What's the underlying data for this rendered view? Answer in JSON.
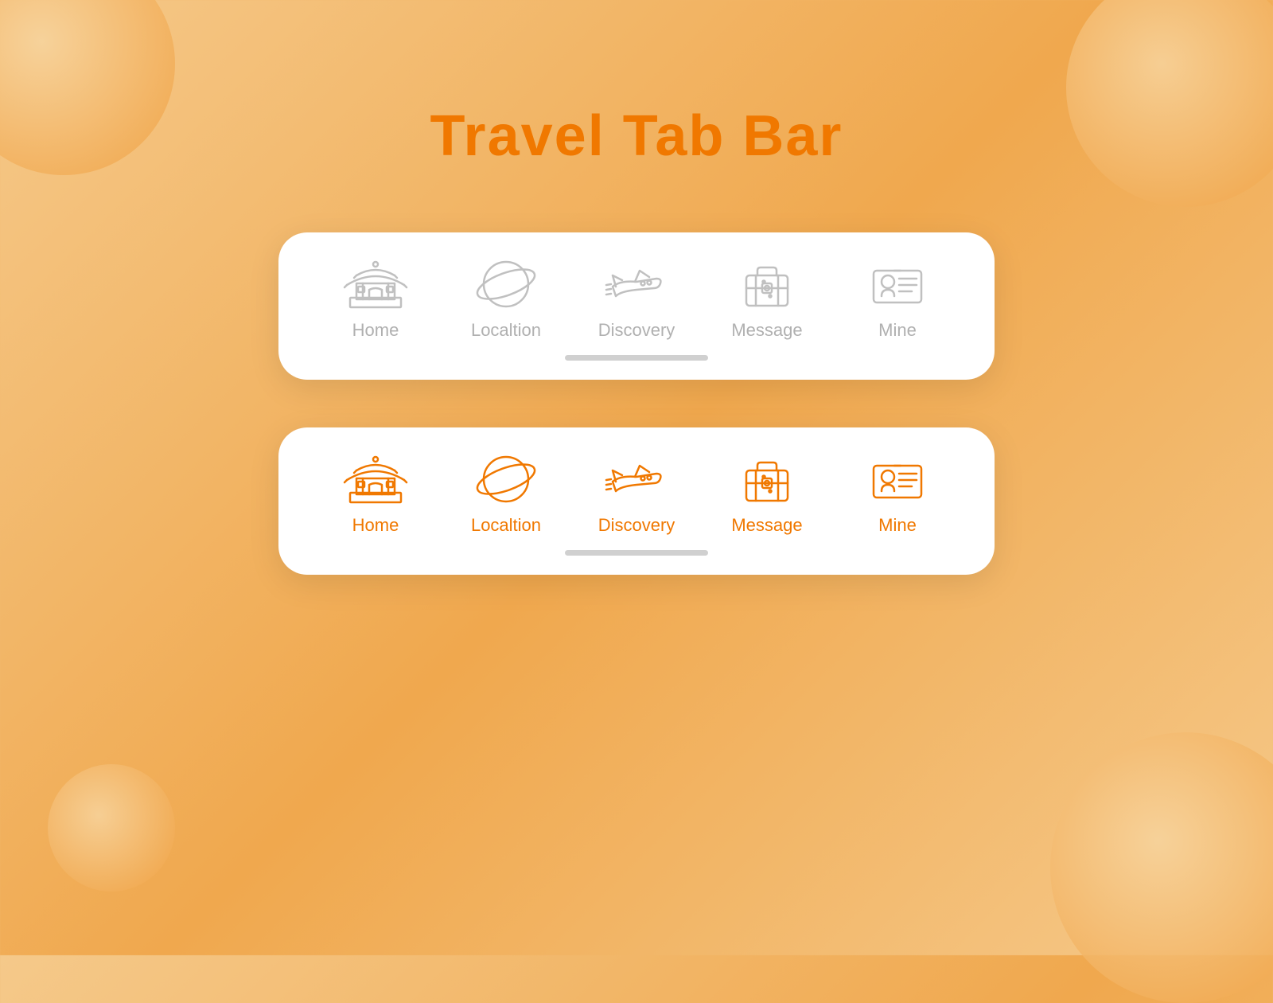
{
  "page": {
    "title": "Travel Tab Bar",
    "title_color": "#f07800"
  },
  "tab_bar_inactive": {
    "tabs": [
      {
        "id": "home",
        "label": "Home"
      },
      {
        "id": "location",
        "label": "Localtion"
      },
      {
        "id": "discovery",
        "label": "Discovery"
      },
      {
        "id": "message",
        "label": "Message"
      },
      {
        "id": "mine",
        "label": "Mine"
      }
    ]
  },
  "tab_bar_active": {
    "tabs": [
      {
        "id": "home",
        "label": "Home"
      },
      {
        "id": "location",
        "label": "Localtion"
      },
      {
        "id": "discovery",
        "label": "Discovery"
      },
      {
        "id": "message",
        "label": "Message"
      },
      {
        "id": "mine",
        "label": "Mine"
      }
    ]
  },
  "colors": {
    "inactive": "#c0c0c0",
    "active": "#f07800",
    "background_start": "#f5c98a",
    "background_end": "#f0a84e",
    "card_bg": "#ffffff"
  }
}
